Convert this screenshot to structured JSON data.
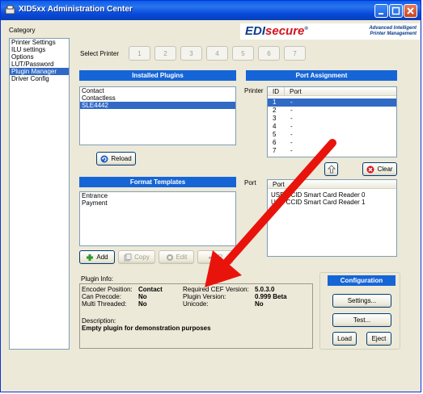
{
  "window": {
    "title": "XID5xx Administration Center"
  },
  "brand": {
    "logo_part1": "EDI",
    "logo_part2": "secure",
    "logo_mark": "®",
    "tagline_1": "Advanced Intelligent",
    "tagline_2": "Printer Management"
  },
  "category": {
    "label": "Category",
    "items": [
      "Printer Settings",
      "ILU settings",
      "Options",
      "LUT/Password",
      "Plugin Manager",
      "Driver Config"
    ],
    "selected_index": 4
  },
  "select_printer": {
    "label": "Select Printer",
    "buttons": [
      "1",
      "2",
      "3",
      "4",
      "5",
      "6",
      "7"
    ]
  },
  "installed_plugins": {
    "header": "Installed Plugins",
    "items": [
      "Contact",
      "Contactless",
      "SLE4442"
    ],
    "selected_index": 2,
    "reload_label": "Reload"
  },
  "port_assignment": {
    "header": "Port Assignment",
    "printer_label": "Printer",
    "col_id": "ID",
    "col_port": "Port",
    "rows": [
      {
        "id": "1",
        "port": "-"
      },
      {
        "id": "2",
        "port": "-"
      },
      {
        "id": "3",
        "port": "-"
      },
      {
        "id": "4",
        "port": "-"
      },
      {
        "id": "5",
        "port": "-"
      },
      {
        "id": "6",
        "port": "-"
      },
      {
        "id": "7",
        "port": "-"
      }
    ],
    "clear_label": "Clear",
    "port_label": "Port",
    "port_col": "Port",
    "ports": [
      "USB CCID Smart Card Reader 0",
      "USB CCID Smart Card Reader 1"
    ]
  },
  "format_templates": {
    "header": "Format Templates",
    "items": [
      "Entrance",
      "Payment"
    ],
    "add_label": "Add",
    "copy_label": "Copy",
    "edit_label": "Edit",
    "remove_label": "R"
  },
  "plugin_info": {
    "label": "Plugin Info:",
    "encoder_position_label": "Encoder Position:",
    "encoder_position_value": "Contact",
    "can_precode_label": "Can Precode:",
    "can_precode_value": "No",
    "multi_threaded_label": "Multi Threaded:",
    "multi_threaded_value": "No",
    "required_cef_label": "Required CEF Version:",
    "required_cef_value": "5.0.3.0",
    "plugin_version_label": "Plugin Version:",
    "plugin_version_value": "0.999 Beta",
    "unicode_label": "Unicode:",
    "unicode_value": "No",
    "description_label": "Description:",
    "description_value": "Empty plugin for demonstration purposes"
  },
  "configuration": {
    "header": "Configuration",
    "settings_label": "Settings...",
    "test_label": "Test...",
    "load_label": "Load",
    "eject_label": "Eject"
  },
  "colors": {
    "accent": "#1565d6",
    "selection": "#316ac5",
    "arrow": "#e8140c",
    "logo_red": "#d4141c",
    "logo_blue": "#0a3b8c"
  }
}
